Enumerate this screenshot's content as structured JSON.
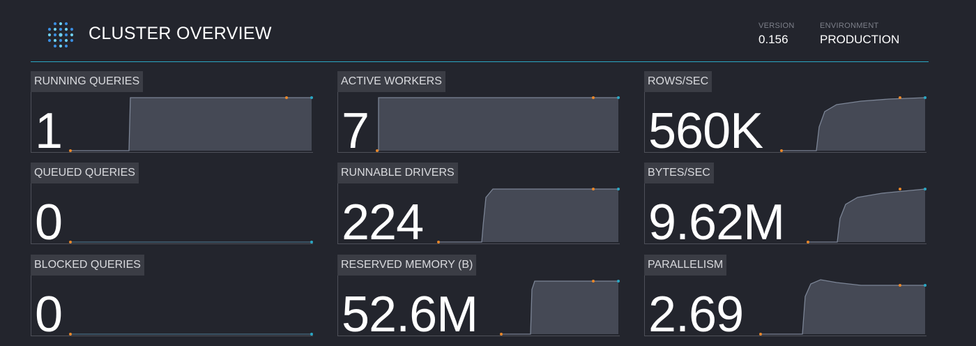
{
  "header": {
    "title": "CLUSTER OVERVIEW",
    "version_label": "VERSION",
    "version_value": "0.156",
    "environment_label": "ENVIRONMENT",
    "environment_value": "PRODUCTION"
  },
  "colors": {
    "accent": "#2aa7c4",
    "start_dot": "#e8872a",
    "end_dot": "#2aa7c4",
    "area_fill": "#454955",
    "area_line": "#7c8596"
  },
  "icons": [
    "logo-icon"
  ],
  "tiles": [
    {
      "label": "RUNNING QUERIES",
      "value": "1"
    },
    {
      "label": "ACTIVE WORKERS",
      "value": "7"
    },
    {
      "label": "ROWS/SEC",
      "value": "560K"
    },
    {
      "label": "QUEUED QUERIES",
      "value": "0"
    },
    {
      "label": "RUNNABLE DRIVERS",
      "value": "224"
    },
    {
      "label": "BYTES/SEC",
      "value": "9.62M"
    },
    {
      "label": "BLOCKED QUERIES",
      "value": "0"
    },
    {
      "label": "RESERVED MEMORY (B)",
      "value": "52.6M"
    },
    {
      "label": "PARALLELISM",
      "value": "2.69"
    }
  ]
}
